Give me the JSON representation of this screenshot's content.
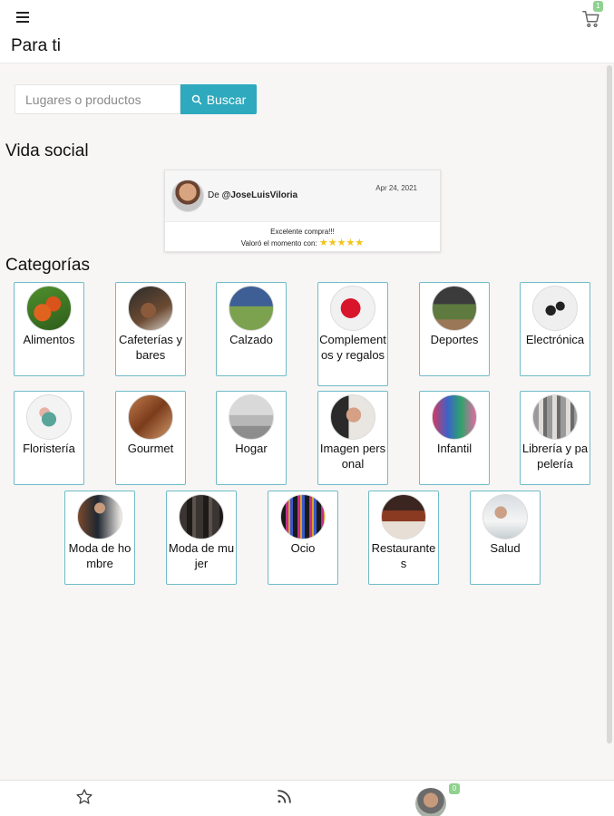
{
  "header": {
    "title": "Para ti",
    "menu_icon": "hamburger-icon",
    "cart_icon": "cart-icon",
    "cart_count": "1"
  },
  "search": {
    "placeholder": "Lugares o productos",
    "value": "",
    "button_label": "Buscar",
    "button_color": "#2ea9bd"
  },
  "social": {
    "title": "Vida social",
    "review": {
      "from_prefix": "De",
      "user": "@JoseLuisViloria",
      "date": "Apr 24, 2021",
      "text": "Excelente compra!!!",
      "rating_label": "Valoró el momento con:",
      "stars": "★★★★★"
    }
  },
  "categories": {
    "title": "Categorías",
    "items": [
      {
        "label": "Alimentos",
        "icon": "vegetables-photo"
      },
      {
        "label": "Cafeterías y bares",
        "icon": "coffee-photo"
      },
      {
        "label": "Calzado",
        "icon": "shoes-photo"
      },
      {
        "label": "Complementos y regalos",
        "icon": "gift-photo"
      },
      {
        "label": "Deportes",
        "icon": "sports-photo"
      },
      {
        "label": "Electrónica",
        "icon": "earbuds-photo"
      },
      {
        "label": "Floristería",
        "icon": "flowers-photo"
      },
      {
        "label": "Gourmet",
        "icon": "gourmet-photo"
      },
      {
        "label": "Hogar",
        "icon": "home-photo"
      },
      {
        "label": "Imagen personal",
        "icon": "beauty-photo"
      },
      {
        "label": "Infantil",
        "icon": "kids-photo"
      },
      {
        "label": "Librería y papelería",
        "icon": "books-photo"
      },
      {
        "label": "Moda de hombre",
        "icon": "menswear-photo"
      },
      {
        "label": "Moda de mujer",
        "icon": "womenswear-photo"
      },
      {
        "label": "Ocio",
        "icon": "leisure-photo"
      },
      {
        "label": "Restaurantes",
        "icon": "restaurant-photo"
      },
      {
        "label": "Salud",
        "icon": "health-photo"
      }
    ]
  },
  "bottom_nav": {
    "favorites_icon": "star-icon",
    "feed_icon": "rss-icon",
    "profile_icon": "avatar",
    "profile_badge": "0"
  }
}
